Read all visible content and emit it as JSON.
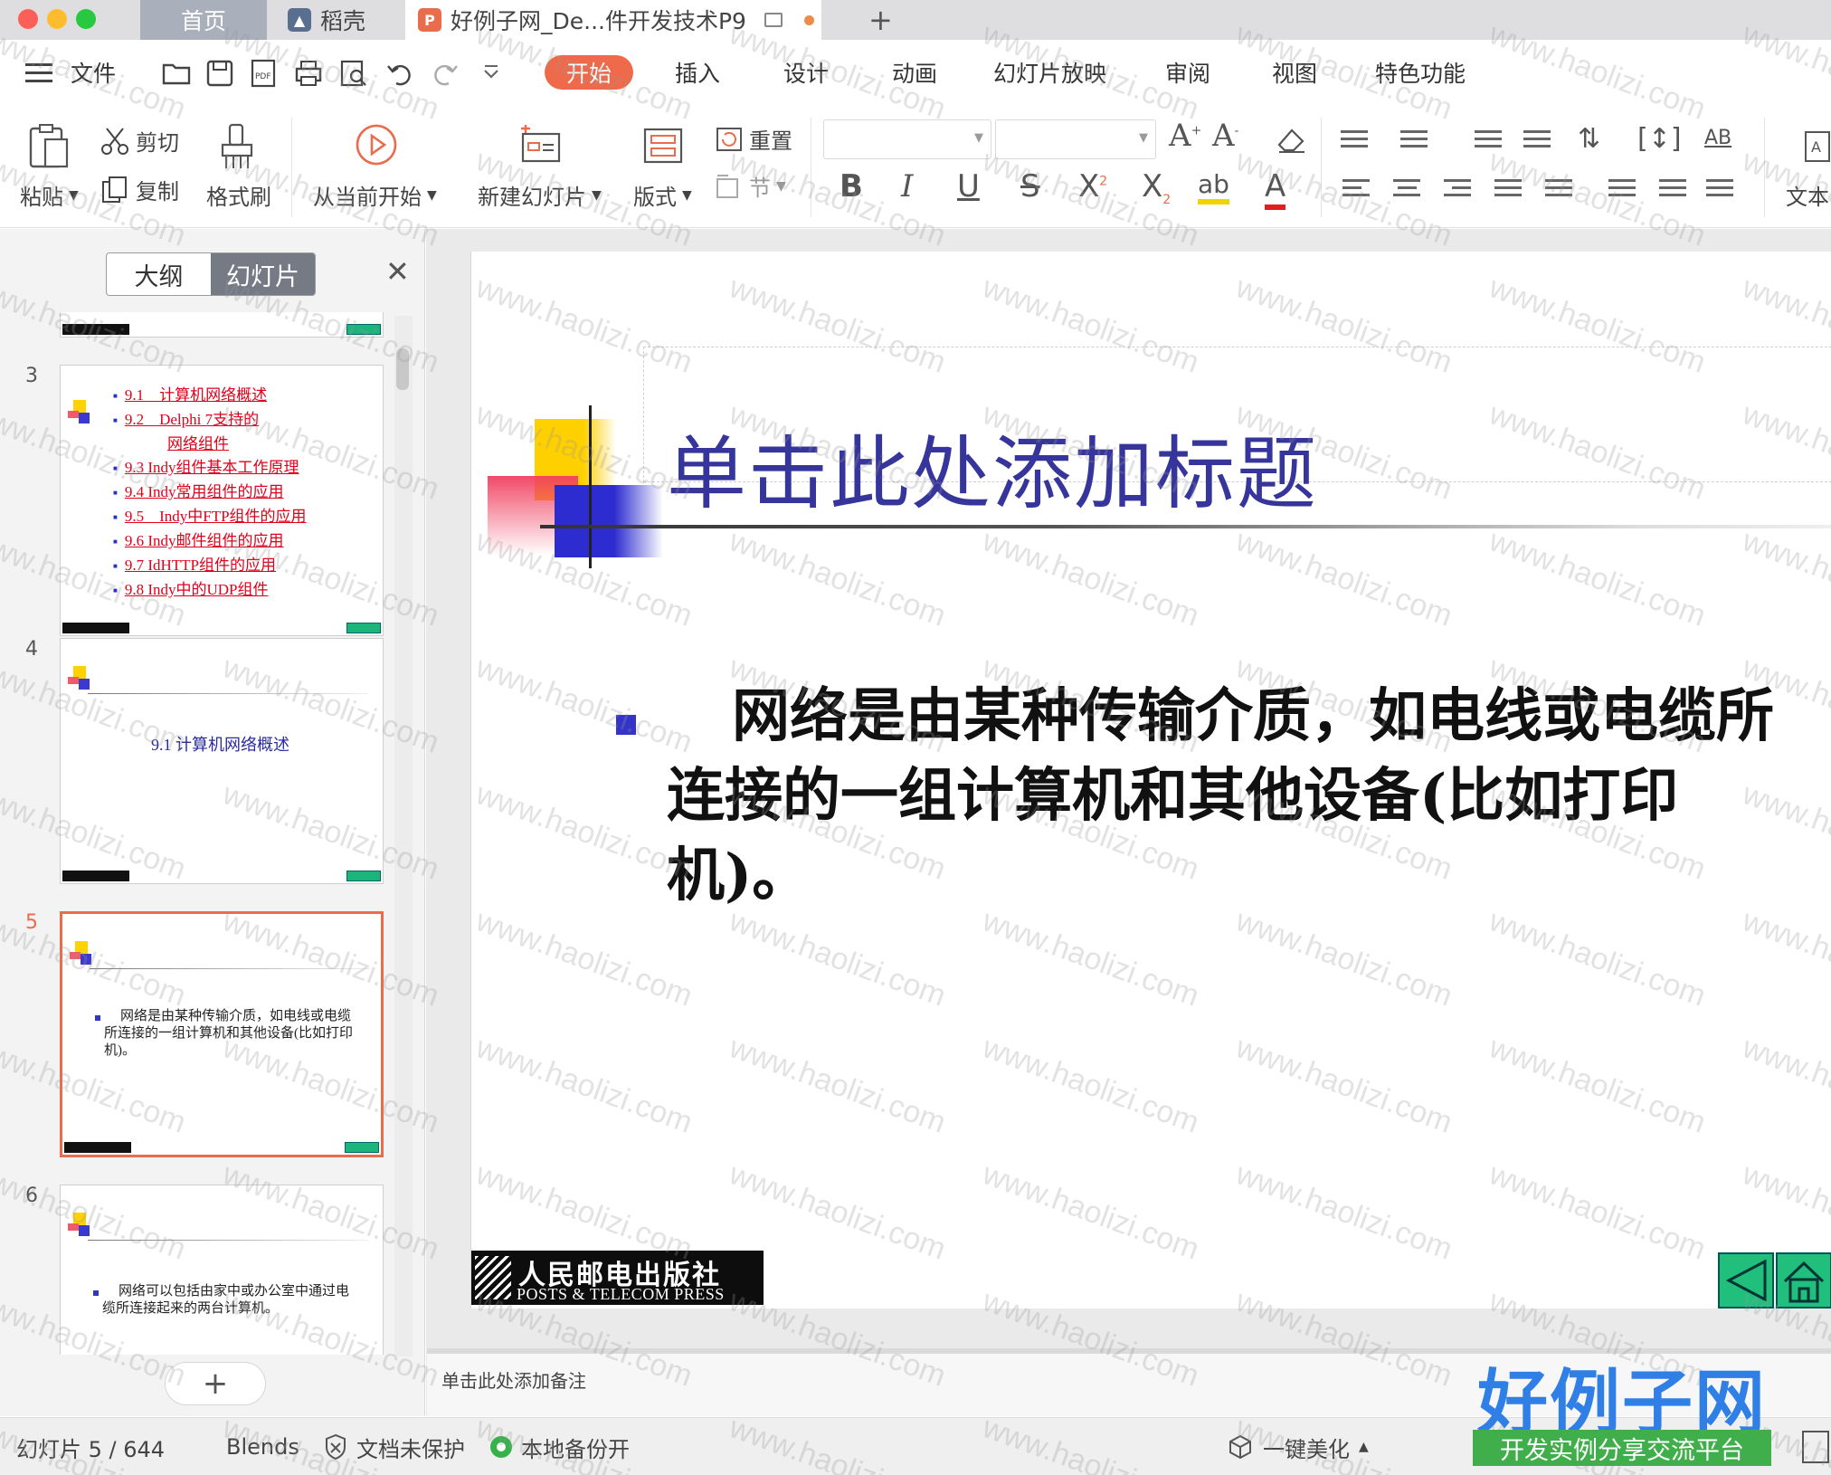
{
  "tabs": [
    {
      "label": "首页"
    },
    {
      "label": "稻壳",
      "icon": "flame-icon"
    },
    {
      "label": "好例子网_De...件开发技术P9",
      "icon": "presentation-file-icon"
    }
  ],
  "menu": [
    "文件",
    "开始",
    "插入",
    "设计",
    "动画",
    "幻灯片放映",
    "审阅",
    "视图",
    "特色功能"
  ],
  "ribbon": {
    "paste": "粘贴",
    "cut": "剪切",
    "copy": "复制",
    "format_painter": "格式刷",
    "play_from_current": "从当前开始",
    "new_slide": "新建幻灯片",
    "layout": "版式",
    "reset": "重置",
    "section": "节",
    "text_box": "文本"
  },
  "left_panel": {
    "outline_tab": "大纲",
    "slides_tab": "幻灯片",
    "slide_numbers": [
      "3",
      "4",
      "5",
      "6"
    ],
    "toc_items": [
      "9.1　计算机网络概述",
      "9.2　Delphi 7支持的",
      "网络组件",
      "9.3  Indy组件基本工作原理",
      "9.4  Indy常用组件的应用",
      "9.5　Indy中FTP组件的应用",
      "9.6  Indy邮件组件的应用",
      "9.7  IdHTTP组件的应用",
      "9.8  Indy中的UDP组件"
    ],
    "slide4_title": "9.1  计算机网络概述",
    "slide5_text": "网络是由某种传输介质，如电线或电缆所连接的一组计算机和其他设备(比如打印机)。",
    "slide6_text": "网络可以包括由家中或办公室中通过电缆所连接起来的两台计算机。"
  },
  "slide": {
    "title": "单击此处添加标题",
    "body": "网络是由某种传输介质，如电线或电缆所连接的一组计算机和其他设备(比如打印机)。",
    "publisher_cn": "人民邮电出版社",
    "publisher_en": "POSTS & TELECOM PRESS"
  },
  "notes_placeholder": "单击此处添加备注",
  "status": {
    "slide_counter": "幻灯片 5 / 644",
    "theme": "Blends",
    "protection": "文档未保护",
    "backup": "本地备份开",
    "beautify": "一键美化"
  },
  "watermark_text": "www.haolizi.com",
  "site_logo": {
    "title": "好例子网",
    "subtitle": "开发实例分享交流平台"
  },
  "colors": {
    "accent": "#ef6a4a",
    "slide_title": "#35359b",
    "toc_link": "#e0001a",
    "nav_button": "#20c07c",
    "logo_blue": "#2f7fe6",
    "logo_green": "#3fae4b"
  }
}
